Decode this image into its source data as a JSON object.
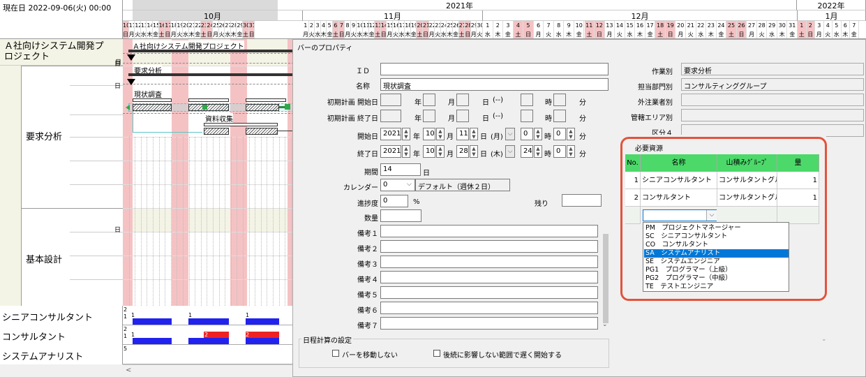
{
  "current_date": "現在日 2022-09-06(火) 00:00",
  "timeline": {
    "year_2021": "2021年",
    "year_2022": "2022年",
    "months": [
      "10月",
      "11月",
      "12月",
      "1月"
    ],
    "oct_days": [
      "10",
      "11",
      "12",
      "13",
      "14",
      "15",
      "16",
      "17",
      "18",
      "19",
      "20",
      "21",
      "22",
      "23",
      "24",
      "25",
      "26",
      "27",
      "28",
      "29",
      "30",
      "31"
    ],
    "oct_weekdays": [
      "日",
      "月",
      "火",
      "水",
      "木",
      "金",
      "土",
      "日",
      "月",
      "火",
      "水",
      "木",
      "金",
      "土",
      "日",
      "月",
      "火",
      "水",
      "木",
      "金",
      "土",
      "日"
    ],
    "nov_days": [
      "1",
      "2",
      "3",
      "4",
      "5",
      "6",
      "7",
      "8",
      "9",
      "10",
      "11",
      "12",
      "13",
      "14",
      "15",
      "16",
      "17",
      "18",
      "19",
      "20",
      "21",
      "22",
      "23",
      "24",
      "25",
      "26",
      "27",
      "28",
      "29",
      "30"
    ],
    "dec_days": [
      "1",
      "2",
      "3",
      "4",
      "5",
      "6",
      "7",
      "8",
      "9",
      "10",
      "11",
      "12",
      "13",
      "14",
      "15",
      "16",
      "17",
      "18",
      "19",
      "20",
      "21",
      "22",
      "23",
      "24",
      "25",
      "26",
      "27",
      "28",
      "29",
      "30",
      "31"
    ],
    "jan_days": [
      "1",
      "2",
      "3",
      "4",
      "5",
      "6",
      "7"
    ],
    "weekday_cycle_nov": [
      "月",
      "火",
      "水",
      "木",
      "金",
      "土",
      "日"
    ]
  },
  "tree": {
    "project": "Ａ社向けシステム開発プロジェクト",
    "phase1": "要求分析",
    "phase2": "基本設計",
    "e_marker": "日"
  },
  "gantt": {
    "project_bar_label": "Ａ社向けシステム開発プロジェクト",
    "task1": "要求分析",
    "task2": "現状調査",
    "task3": "資料収集"
  },
  "resources": [
    {
      "name": "シニアコンサルタント",
      "scale_top": "2",
      "scale_bottom": "1",
      "marks": [
        "1",
        "1",
        "1"
      ]
    },
    {
      "name": "コンサルタント",
      "scale_top": "2",
      "scale_bottom": "1",
      "marks": [
        "1",
        "2",
        "2"
      ]
    },
    {
      "name": "システムアナリスト",
      "scale_top": "5"
    }
  ],
  "dialog": {
    "title": "バーのプロパティ",
    "id_label": "ＩＤ",
    "name_label": "名称",
    "name_value": "現状調査",
    "plan_start_label": "初期計画 開始日",
    "plan_end_label": "初期計画 終了日",
    "start_label": "開始日",
    "end_label": "終了日",
    "year_unit": "年",
    "month_unit": "月",
    "day_unit": "日",
    "hour_unit": "時",
    "minute_unit": "分",
    "blank_dow": "(--)",
    "start": {
      "year": "2021",
      "month": "10",
      "day": "11",
      "dow": "(月)",
      "hour": "0",
      "minute": "0"
    },
    "end": {
      "year": "2021",
      "month": "10",
      "day": "28",
      "dow": "(木)",
      "hour": "24",
      "minute": "0"
    },
    "duration_label": "期間",
    "duration_value": "14",
    "duration_unit": "日",
    "calendar_label": "カレンダー",
    "calendar_value": "0",
    "calendar_name": "デフォルト（週休２日）",
    "progress_label": "進捗度",
    "progress_value": "0",
    "progress_unit": "%",
    "remaining_label": "残り",
    "quantity_label": "数量",
    "notes": [
      "備考１",
      "備考２",
      "備考３",
      "備考４",
      "備考５",
      "備考６",
      "備考７"
    ],
    "schedule_group_label": "日程計算の設定",
    "check1": "バーを移動しない",
    "check2": "後続に影響しない範囲で遅く開始する",
    "categories": [
      {
        "label": "作業別",
        "value": "要求分析"
      },
      {
        "label": "担当部門別",
        "value": "コンサルティンググループ"
      },
      {
        "label": "外注業者別",
        "value": ""
      },
      {
        "label": "管轄エリア別",
        "value": ""
      },
      {
        "label": "区分４",
        "value": ""
      }
    ],
    "required_resources": {
      "title": "必要資源",
      "headers": [
        "No.",
        "名称",
        "山積みｸﾞﾙｰﾌﾟ",
        "量"
      ],
      "rows": [
        {
          "no": "1",
          "name": "シニアコンサルタント",
          "group": "コンサルタントグループ",
          "qty": "1"
        },
        {
          "no": "2",
          "name": "コンサルタント",
          "group": "コンサルタントグループ",
          "qty": "1"
        }
      ],
      "dropdown_options": [
        "PM　プロジェクトマネージャー",
        "SC　シニアコンサルタント",
        "CO　コンサルタント",
        "SA　システムアナリスト",
        "SE　システムエンジニア",
        "PG1　プログラマー（上級）",
        "PG2　プログラマー（中級）",
        "TE　テストエンジニア"
      ],
      "selected_option_index": 3
    }
  }
}
